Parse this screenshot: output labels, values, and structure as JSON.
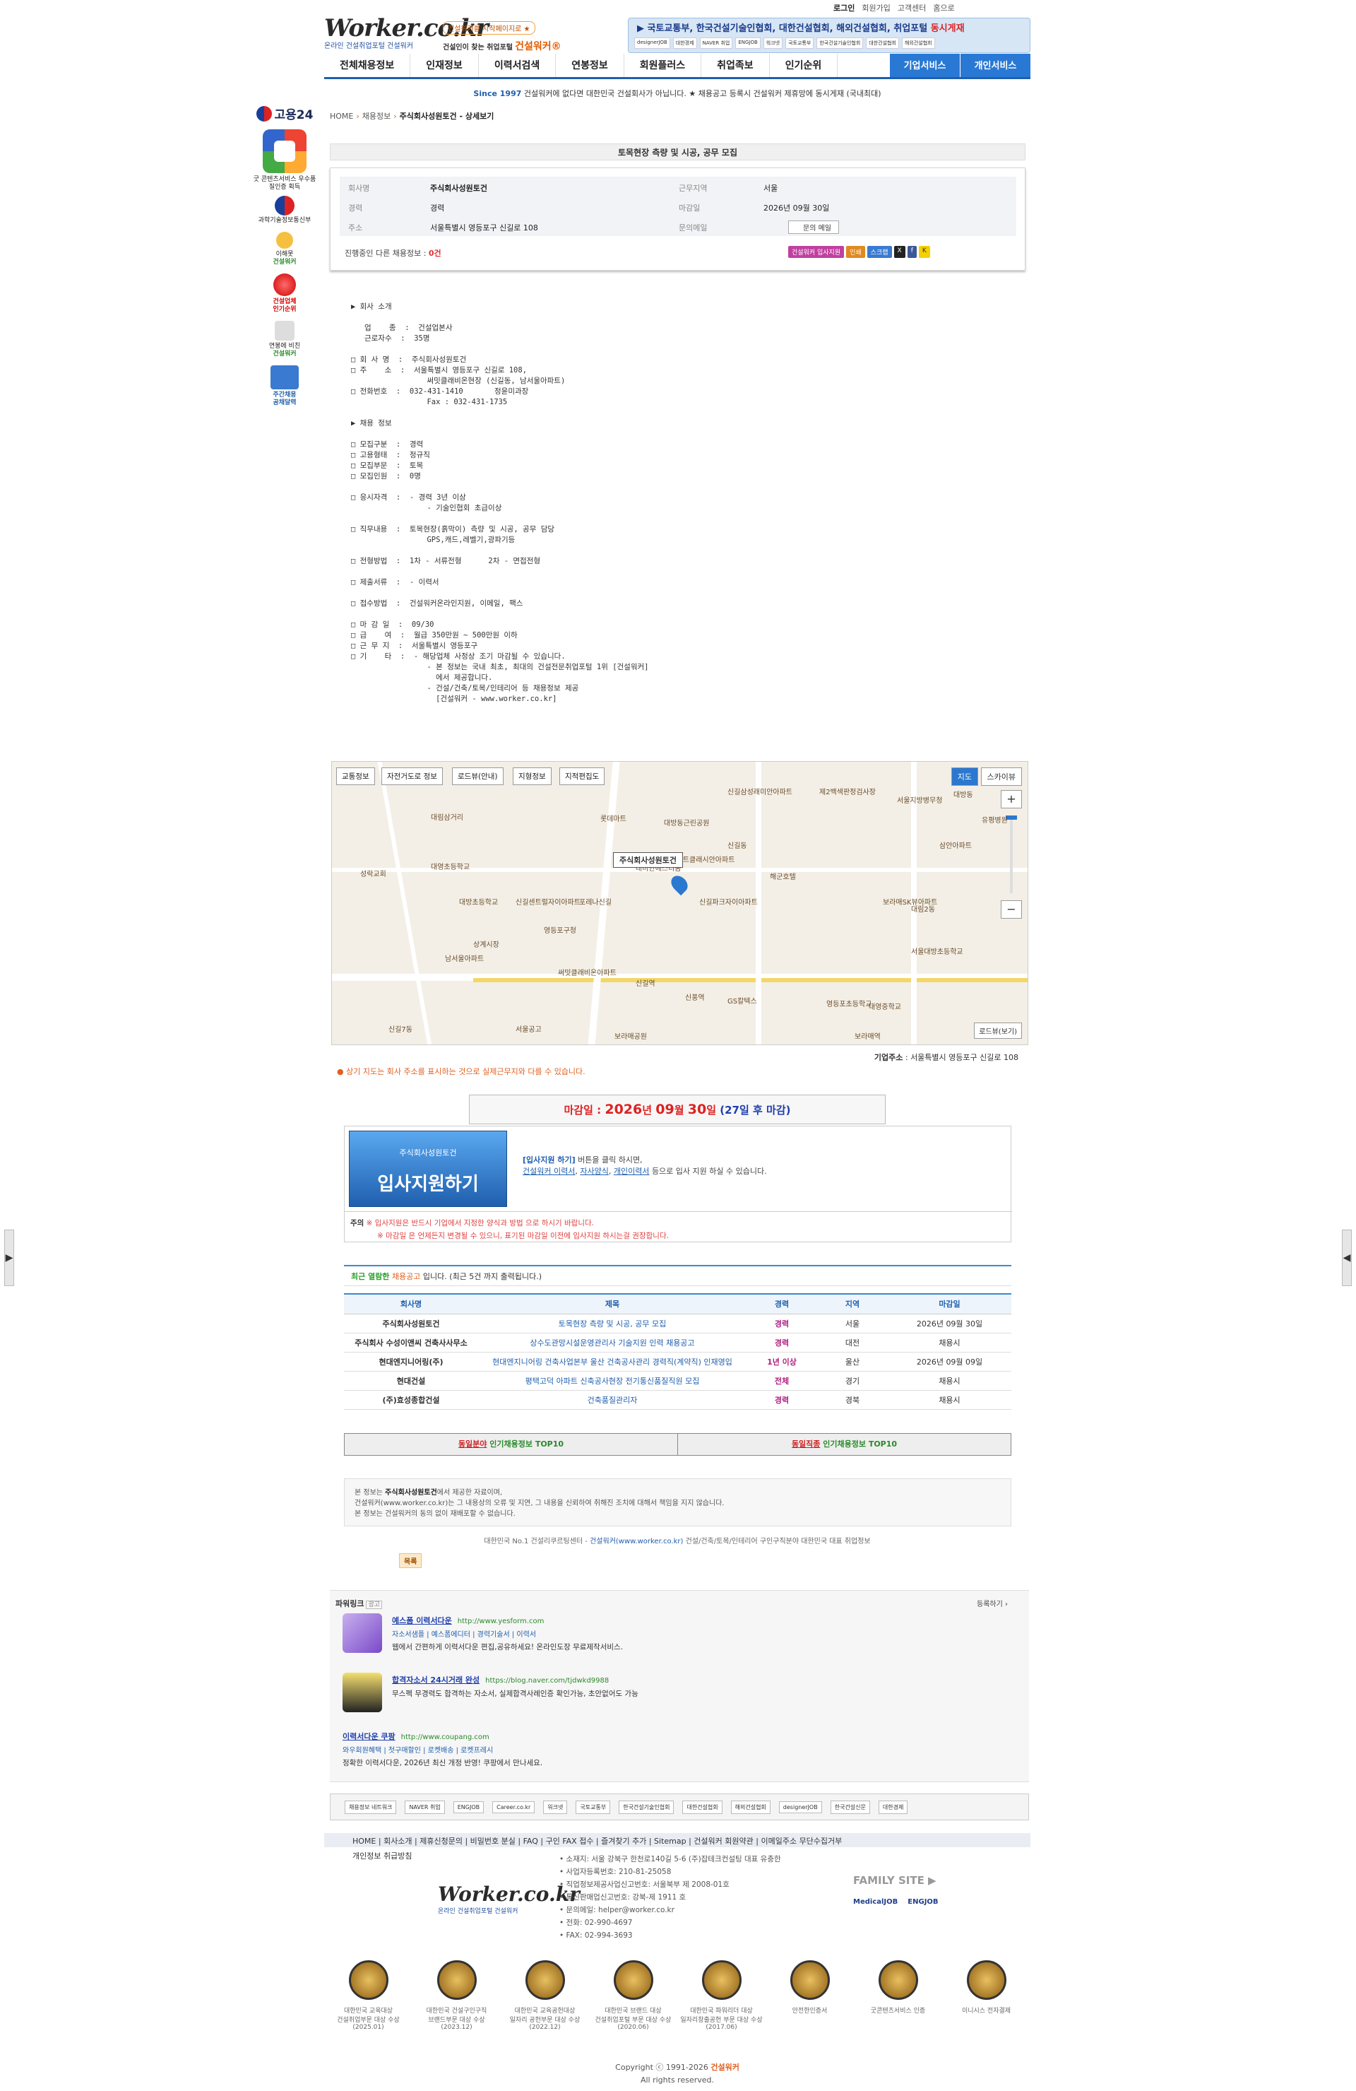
{
  "util": {
    "login": "로그인",
    "join": "회원가입",
    "center": "고객센터",
    "home": "홈으로"
  },
  "logo": {
    "main": "Worker.co.kr",
    "sub": "온라인 건설취업포털 건설워커"
  },
  "tagline": {
    "pill": "건설워커를 시작페이지로 ★",
    "line": "건설인이 찾는 취업포털",
    "brand": "건설워커®"
  },
  "partners": {
    "title": "▶ 국토교통부, 한국건설기술인협회, 대한건설협회, 해외건설협회, 취업포털",
    "highlight": "동시게재",
    "logos": [
      "designerJOB",
      "대한경제",
      "NAVER 취업",
      "ENGJOB",
      "워크넷",
      "국토교통부",
      "한국건설기술인협회",
      "대한건설협회",
      "해외건설협회"
    ]
  },
  "gnb": {
    "items": [
      "전체채용정보",
      "인재정보",
      "이력서검색",
      "연봉정보",
      "회원플러스",
      "취업족보",
      "인기순위"
    ],
    "services": [
      "기업서비스",
      "개인서비스"
    ]
  },
  "notice": {
    "since": "Since 1997",
    "text": "건설워커에 없다면 대한민국 건설회사가 아닙니다. ★ 채용공고 등록시 건설워커 제휴망에 동시게재 (국내최대)"
  },
  "side": {
    "g24": "고용24",
    "award1": "굿 콘텐츠서비스 우수품질인증 획득",
    "ministry": "과학기술정보통신부",
    "b1": "이해못",
    "b1b": "건설워커",
    "b2": "건설업체",
    "b2b": "인기순위",
    "b3": "연봉에 비친",
    "b3b": "건설워커",
    "b4": "주간채용",
    "b4b": "공채달력"
  },
  "crumb": {
    "home": "HOME",
    "c1": "채용정보",
    "c2": "주식회사성원토건 - 상세보기"
  },
  "job": {
    "title": "토목현장 측량 및 시공, 공무 모집",
    "company_k": "회사명",
    "company": "주식회사성원토건",
    "loc_k": "근무지역",
    "loc": "서울",
    "career_k": "경력",
    "career": "경력",
    "deadline_k": "마감일",
    "deadline": "2026년 09월 30일",
    "addr_k": "주소",
    "addr": "서울특별시 영등포구 신길로 108",
    "mail_k": "문의메일",
    "mail": "문의 메일",
    "other": "진행중인 다른 채용정보 :",
    "other_n": "0건",
    "buttons": [
      "건설워커 입사지원",
      "인쇄",
      "스크랩"
    ]
  },
  "pre": "▶ 회사 소개\n\n   업    종  :  건설업본사\n   근로자수  :  35명\n\n□ 회 사 명  :  주식회사성원토건\n□ 주    소  :  서울특별시 영등포구 신길로 108,\n                 써밋클래비온현장 (신길동, 남서울아파트)\n□ 전화번호  :  032-431-1410       정윤미과장\n                 Fax : 032-431-1735\n\n▶ 채용 정보\n\n□ 모집구분  :  경력\n□ 고용형태  :  정규직\n□ 모집부문  :  토목\n□ 모집인원  :  0명\n\n□ 응시자격  :  - 경력 3년 이상\n                 - 기술인협회 초급이상\n\n□ 직무내용  :  토목현장(흙막이) 측량 및 시공, 공무 담당\n                 GPS,캐드,레벨기,광파기등\n\n□ 전형방법  :  1차 - 서류전형      2차 - 면접전형\n\n□ 제출서류  :  - 이력서\n\n□ 접수방법  :  건설워커온라인지원, 이메일, 팩스\n\n□ 마 감 일  :  09/30\n□ 급    여  :  월급 350만원 ~ 500만원 이하\n□ 근 무 지  :  서울특별시 영등포구\n□ 기    타  :  - 해당업체 사정상 조기 마감될 수 있습니다.\n                 - 본 정보는 국내 최초, 최대의 건설전문취업포털 1위 [건설워커]\n                   에서 제공합니다.\n                 - 건설/건축/토목/인테리어 등 채용정보 제공\n                   [건설워커 - www.worker.co.kr]",
  "map": {
    "buttons": [
      "교통정보",
      "자전거도로 정보",
      "로드뷰(안내)",
      "지형정보",
      "지적편집도"
    ],
    "toggle": [
      "지도",
      "스카이뷰"
    ],
    "pin": "주식회사성원토건",
    "roadview": "로드뷰(보기)",
    "labels": [
      "신길삼성래미안아파트",
      "제2백색판정검사장",
      "서울지방병무청",
      "대방동",
      "대방동근린공원",
      "유평병원",
      "삼안아파트",
      "롯데마트",
      "대림삼거리",
      "해군호텔",
      "대영초등학교",
      "신길센트럴자이아파트",
      "포레나신길",
      "래미안에스티움",
      "신길파크자이아파트",
      "힐스테이트클래시안아파트",
      "신길동",
      "성락교회",
      "대림2동",
      "남서울아파트",
      "써밋클래비온아파트",
      "신길역",
      "대방초등학교",
      "보라매SK뷰아파트",
      "영등포구청",
      "상계시장",
      "신풍역",
      "GS칼텍스",
      "신길7동",
      "영등포초등학교",
      "대영중학교",
      "서울대방초등학교",
      "보라매역",
      "보라매공원",
      "서울공고",
      "신풍초등학교"
    ]
  },
  "addr_line": {
    "k": "기업주소",
    "v": "서울특별시 영등포구 신길로 108"
  },
  "warn": "상기 지도는 회사 주소를 표시하는 것으로 실제근무지와 다를 수 있습니다.",
  "deadline": {
    "pre": "마감일 :",
    "y": "2026",
    "m": "09",
    "d": "30",
    "left": "(27일 후 마감)"
  },
  "apply": {
    "small": "주식회사성원토건",
    "big": "입사지원하기",
    "d1a": "[입사지원 하기]",
    "d1b": "버튼을 클릭 하시면,",
    "d2a": "건설워커 이력서",
    "d2b": "자사양식",
    "d2c": "개인이력서",
    "d2d": "등으로 입사 지원 하실 수 있습니다.",
    "note_t": "주의",
    "n1": "※ 입사지원은 반드시 기업에서 지정한 양식과 방법 으로 하시기 바랍니다.",
    "n2": "※ 마감일 은 언제든지 변경될 수 있으니, 표기된 마감일 이전에 입사지원 하시는걸 권장합니다."
  },
  "recent": {
    "h1": "최근 열람한",
    "h2": "채용공고",
    "h3": "입니다.   (최근 5건 까지 출력됩니다.)",
    "cols": [
      "회사명",
      "제목",
      "경력",
      "지역",
      "마감일"
    ],
    "rows": [
      [
        "주식회사성원토건",
        "토목현장 측량 및 시공, 공무 모집",
        "경력",
        "서울",
        "2026년 09월 30일"
      ],
      [
        "주식회사 수성이앤씨 건축사사무소",
        "상수도관망시설운영관리사 기술지원 인력 채용공고",
        "경력",
        "대전",
        "채용시"
      ],
      [
        "현대엔지니어링(주)",
        "현대엔지니어링 건축사업본부 울산 건축공사관리 경력직(계약직) 인재영입",
        "1년 이상",
        "울산",
        "2026년 09월 09일"
      ],
      [
        "현대건설",
        "평택고덕 아파트 신축공사현장 전기통신품질직원 모집",
        "전체",
        "경기",
        "채용시"
      ],
      [
        "(주)효성종합건설",
        "건축품질관리자",
        "경력",
        "경북",
        "채용시"
      ]
    ]
  },
  "top10": {
    "a1": "동일분야",
    "a2": "인기채용정보 TOP10",
    "b1": "동일직종",
    "b2": "인기채용정보 TOP10"
  },
  "disc": {
    "l1a": "본 정보는",
    "l1b": "주식회사성원토건",
    "l1c": "에서 제공한 자료이며,",
    "l2": "건설워커(www.worker.co.kr)는 그 내용상의 오류 및 지연, 그 내용을 신뢰하여 취해진 조치에 대해서 책임을 지지 않습니다.",
    "l3": "본 정보는 건설워커의 동의 없이 재배포할 수 없습니다."
  },
  "corp": {
    "a": "대한민국 No.1 건설리쿠르팅센터 -",
    "b": "건설워커(www.worker.co.kr)",
    "c": "건설/건축/토목/인테리어 구인구직분야 대한민국 대표 취업정보"
  },
  "list_btn": "목록",
  "ads": {
    "title": "파워링크",
    "badge": "광고",
    "more": "등록하기 ›",
    "a1": {
      "t": "예스폼 이력서다운",
      "u": "http://www.yesform.com",
      "s": "자소서샘플 | 예스폼에디터 | 경력기술서 | 이력서",
      "d": "웹에서 간편하게 이력서다운 편집,공유하세요! 온라인도장 무료제작서비스."
    },
    "a2": {
      "t": "합격자소서 24시거래 완성",
      "u": "https://blog.naver.com/tjdwkd9988",
      "d": "무스펙 무경력도 합격하는 자소서, 실제합격사례인증 확인가능, 초안없어도 가능"
    },
    "a3": {
      "t": "이력서다운 쿠팡",
      "u": "http://www.coupang.com",
      "s": "와우회원혜택 | 첫구매할인 | 로켓배송 | 로켓프레시",
      "d": "정확한 이력서다운, 2026년 최신 개정 반영! 쿠팡에서 만나세요."
    }
  },
  "pbar": [
    "채용정보 네트워크",
    "NAVER 취업",
    "ENGJOB",
    "Career.co.kr",
    "워크넷",
    "국토교통부",
    "한국건설기술인협회",
    "대한건설협회",
    "해외건설협회",
    "designerJOB",
    "한국건설신문",
    "대한경제"
  ],
  "fnav": "HOME | 회사소개 | 제휴신청문의 | 비밀번호 분실 | FAQ | 구인 FAX 접수 | 즐겨찾기 추가 | Sitemap | 건설워커 회원약관 | 이메일주소 무단수집거부",
  "privacy": "개인정보 취급방침",
  "flogo": {
    "main": "Worker.co.kr",
    "sub": "온라인 건설취업포털 건설워커"
  },
  "finfo": [
    "• 소재지: 서울 강북구 한천로140길 5-6 (주)잡테크컨설팅 대표 유충한",
    "• 사업자등록번호: 210-81-25058",
    "• 직업정보제공사업신고번호: 서울북부 제 2008-01호",
    "• 통신판매업신고번호: 강북-제 1911 호",
    "• 문의메일: helper@worker.co.kr",
    "• 전화: 02-990-4697",
    "• FAX: 02-994-3693"
  ],
  "family": "FAMILY SITE ▶",
  "family_sites": [
    "MedicalJOB",
    "ENGJOB"
  ],
  "awards": [
    [
      "대한민국 교육대상",
      "건설취업부문 대상 수상",
      "(2025.01)"
    ],
    [
      "대한민국 건설구인구직",
      "브랜드부문 대상 수상",
      "(2023.12)"
    ],
    [
      "대한민국 교육공헌대상",
      "일자리 공헌부문 대상 수상",
      "(2022.12)"
    ],
    [
      "대한민국 브랜드 대상",
      "건설취업포털 부문 대상 수상",
      "(2020.06)"
    ],
    [
      "대한민국 파워리더 대상",
      "일자리창출공헌 부문 대상 수상",
      "(2017.06)"
    ],
    [
      "안전한인증서",
      "",
      ""
    ],
    [
      "굿콘텐츠서비스 인증",
      "",
      ""
    ],
    [
      "이니시스 전자결제",
      "",
      ""
    ]
  ],
  "copy": {
    "a": "Copyright ⓒ 1991-2026",
    "b": "건설워커",
    "c": "All rights reserved."
  }
}
